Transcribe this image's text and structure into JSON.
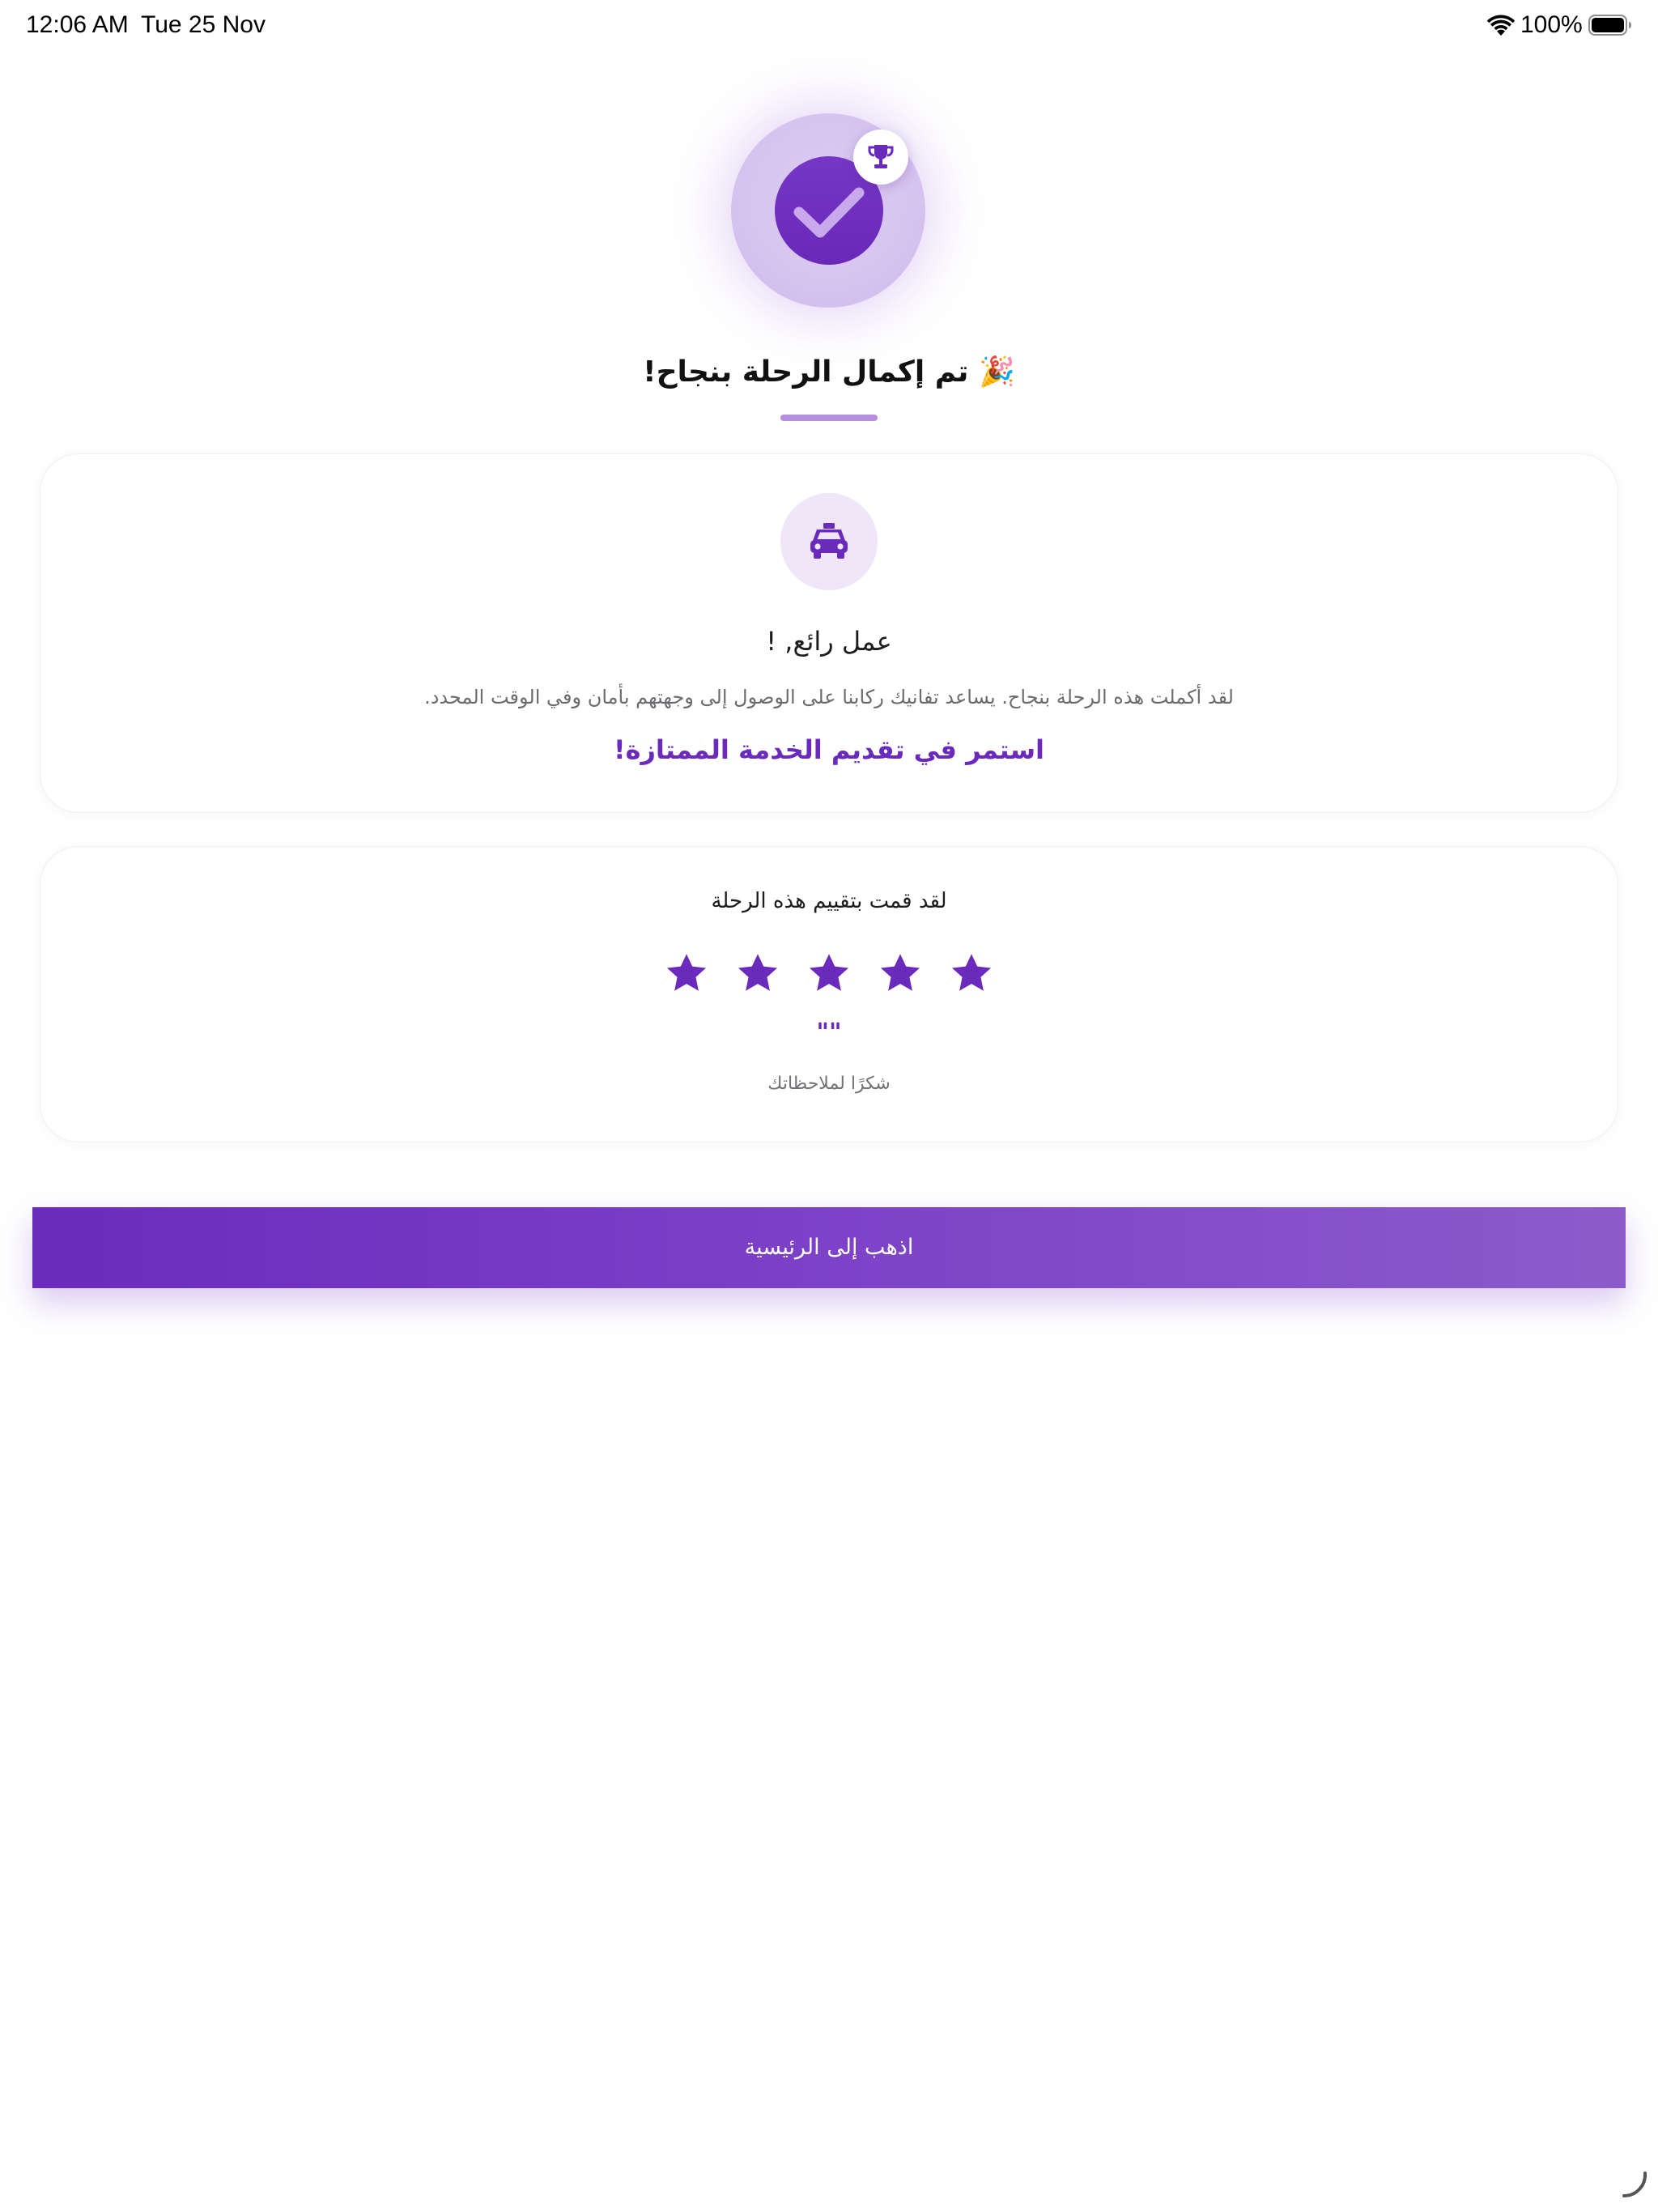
{
  "status_bar": {
    "time": "12:06 AM",
    "date": "Tue 25 Nov",
    "battery_percent": "100%",
    "icons": [
      "wifi-icon",
      "battery-icon"
    ]
  },
  "hero": {
    "icons": [
      "check-icon",
      "trophy-icon"
    ],
    "accent_color": "#6a2bbd"
  },
  "title": "🎉 تم إكمال الرحلة بنجاح!",
  "success_card": {
    "icon": "taxi-icon",
    "heading": "عمل رائع, !",
    "description": "لقد أكملت هذه الرحلة بنجاح. يساعد تفانيك ركابنا على الوصول إلى وجهتهم بأمان وفي الوقت المحدد.",
    "encouragement": "استمر في تقديم الخدمة الممتازة!"
  },
  "rating_card": {
    "heading": "لقد قمت بتقييم هذه الرحلة",
    "rating": 5,
    "max_rating": 5,
    "comment": "\"\"",
    "thanks": "شكرًا لملاحظاتك"
  },
  "home_button": {
    "label": "اذهب إلى الرئيسية"
  },
  "colors": {
    "primary": "#6a2bbd",
    "primary_light": "#efe6f8",
    "button_gradient_start": "#6b2bbd",
    "button_gradient_end": "#8c5bcb"
  }
}
